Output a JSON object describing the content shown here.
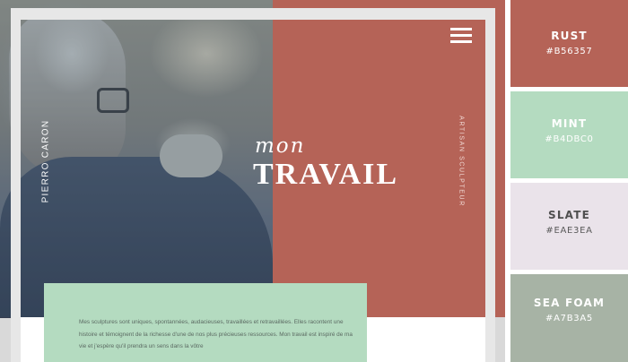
{
  "site": {
    "name_vertical": "PIERRO CARON",
    "role_vertical": "ARTISAN SCULPTEUR",
    "title_small": "mon",
    "title_large": "TRAVAIL",
    "menu_icon": "hamburger-menu-icon",
    "description": "Mes sculptures sont uniques, spontannées, audacieuses, travaillées et retravaillées. Elles racontent une histoire et témoignent de la richesse d'une de nos plus précieuses ressources. Mon travail est inspiré de ma vie et j'espère qu'il prendra un sens dans la vôtre"
  },
  "palette": [
    {
      "name": "RUST",
      "hex": "#B56357"
    },
    {
      "name": "MINT",
      "hex": "#B4DBC0"
    },
    {
      "name": "SLATE",
      "hex": "#EAE3EA"
    },
    {
      "name": "SEA FOAM",
      "hex": "#A7B3A5"
    }
  ]
}
